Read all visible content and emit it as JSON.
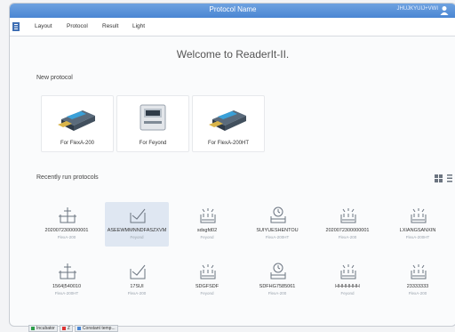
{
  "window": {
    "title": "Protocol Name",
    "user": "JHUJKYUIJ+VWI",
    "colors": {
      "titlebar": "#4a86d3",
      "selected_tile": "#dfe7f2"
    }
  },
  "menu": {
    "items": [
      {
        "label": "Layout"
      },
      {
        "label": "Protocol"
      },
      {
        "label": "Result"
      },
      {
        "label": "Light"
      }
    ]
  },
  "welcome": "Welcome to ReaderIt-II.",
  "new_protocol": {
    "title": "New protocol",
    "cards": [
      {
        "label": "For FlexA-200",
        "icon": "plate-reader-icon"
      },
      {
        "label": "For Feyond",
        "icon": "cabinet-reader-icon"
      },
      {
        "label": "For FlexA-200HT",
        "icon": "plate-reader-icon"
      }
    ]
  },
  "recent": {
    "title": "Recently run protocols",
    "items": [
      {
        "name": "2020072300000001",
        "device": "FlexA-200",
        "icon": "crosshair-plate-icon"
      },
      {
        "name": "ASEEWMMNNDFASZXVM",
        "device": "Feyond",
        "icon": "checkmark-plate-icon",
        "selected": true
      },
      {
        "name": "sdsgfd02",
        "device": "Feyond",
        "icon": "wells-plate-icon"
      },
      {
        "name": "SUIYUESHENTOU",
        "device": "FlexA-200HT",
        "icon": "clock-plate-icon"
      },
      {
        "name": "2020072300000001",
        "device": "FlexA-200",
        "icon": "wells-plate-icon"
      },
      {
        "name": "LXIANGSANXIN",
        "device": "FlexA-200HT",
        "icon": "wells-plate-icon"
      },
      {
        "name": "1564|540010",
        "device": "FlexA-200HT",
        "icon": "crosshair-plate-icon"
      },
      {
        "name": "17SUI",
        "device": "FlexA-200",
        "icon": "checkmark-plate-icon"
      },
      {
        "name": "SDGFSDF",
        "device": "Feyond",
        "icon": "wells-plate-icon"
      },
      {
        "name": "SDFHG7585061",
        "device": "FlexA-200",
        "icon": "clock-plate-icon"
      },
      {
        "name": "HHHHHHH",
        "device": "Feyond",
        "icon": "wells-plate-icon"
      },
      {
        "name": "23333333",
        "device": "FlexA-200",
        "icon": "wells-plate-icon"
      }
    ]
  },
  "statusbar": [
    {
      "label": "Incubator",
      "color": "#2e9e4a"
    },
    {
      "label": "Z",
      "color": "#d33"
    },
    {
      "label": "Constant temp...",
      "color": "#4a86d3"
    }
  ]
}
